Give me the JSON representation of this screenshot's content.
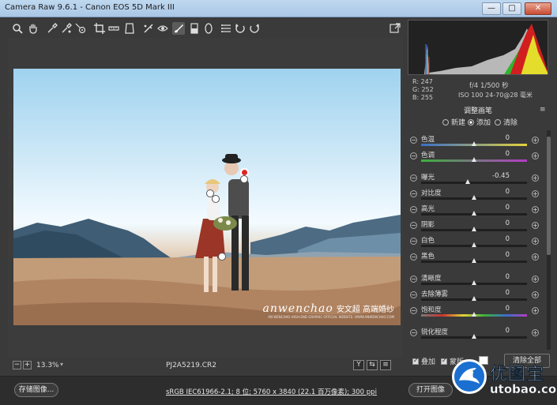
{
  "window": {
    "title": "Camera Raw 9.6.1 -  Canon EOS 5D Mark III",
    "minimize_glyph": "—",
    "maximize_glyph": "□",
    "close_glyph": "✕"
  },
  "toolbar": {
    "tools": [
      "zoom-icon",
      "hand-icon",
      "white-balance-icon",
      "color-sampler-icon",
      "targeted-adjust-icon",
      "crop-icon",
      "straighten-icon",
      "transform-icon",
      "spot-removal-icon",
      "red-eye-icon",
      "adjustment-brush-icon",
      "graduated-filter-icon",
      "radial-filter-icon",
      "preferences-icon",
      "rotate-left-icon",
      "rotate-right-icon"
    ],
    "fullscreen_icon": "fullscreen-icon"
  },
  "preview": {
    "watermark": {
      "brand": "anwenchao",
      "cn": "安文超 高端婚纱",
      "small": "AN WENCHAO HIGH-END GRAPHIC OFFICIAL WEBSITE: WWW.ANWENCHAO.COM"
    }
  },
  "preview_bar": {
    "zoom_out": "−",
    "zoom_in": "+",
    "zoom": "13.3%",
    "zoom_dropdown": "▾",
    "filename": "PJ2A5219.CR2",
    "view_y": "Y",
    "view_toggle": "⇆",
    "view_settings": "≡"
  },
  "histogram": {
    "rgb_r": "R:  247",
    "rgb_g": "G:  252",
    "rgb_b": "B:  255",
    "camera_line1": "f/4  1/500 秒",
    "camera_line2": "ISO 100  24-70@28 毫米"
  },
  "panel": {
    "title": "调整画笔",
    "menu_glyph": "≡",
    "modes": [
      {
        "label": "新建",
        "selected": false
      },
      {
        "label": "添加",
        "selected": true
      },
      {
        "label": "清除",
        "selected": false
      }
    ],
    "sliders": [
      {
        "label": "色温",
        "value": "0",
        "pos": 0.5,
        "track": "temp"
      },
      {
        "label": "色调",
        "value": "0",
        "pos": 0.5,
        "track": "tint"
      },
      {
        "label": "曝光",
        "value": "-0.45",
        "pos": 0.44,
        "track": "plain"
      },
      {
        "label": "对比度",
        "value": "0",
        "pos": 0.5,
        "track": "plain"
      },
      {
        "label": "高光",
        "value": "0",
        "pos": 0.5,
        "track": "plain"
      },
      {
        "label": "阴影",
        "value": "0",
        "pos": 0.5,
        "track": "plain"
      },
      {
        "label": "白色",
        "value": "0",
        "pos": 0.5,
        "track": "plain"
      },
      {
        "label": "黑色",
        "value": "0",
        "pos": 0.5,
        "track": "plain"
      },
      {
        "label": "清晰度",
        "value": "0",
        "pos": 0.5,
        "track": "plain"
      },
      {
        "label": "去除薄雾",
        "value": "0",
        "pos": 0.5,
        "track": "plain"
      },
      {
        "label": "饱和度",
        "value": "0",
        "pos": 0.5,
        "track": "sat"
      },
      {
        "label": "锐化程度",
        "value": "0",
        "pos": 0.5,
        "track": "plain"
      }
    ],
    "overlay_label": "叠加",
    "mask_label": "蒙版",
    "clear_all": "清除全部"
  },
  "footer": {
    "save_image": "存储图像...",
    "workflow_link": "sRGB IEC61966-2.1; 8 位; 5760 x 3840 (22.1 百万像素); 300 ppi",
    "open_image": "打开图像"
  },
  "site_logo": {
    "cn": "优图宝",
    "url": "utobao.com"
  },
  "colors": {
    "panel_bg": "#3a3a3a",
    "footer_bg": "#2d2d2d",
    "pin_active": "#e0242a"
  }
}
